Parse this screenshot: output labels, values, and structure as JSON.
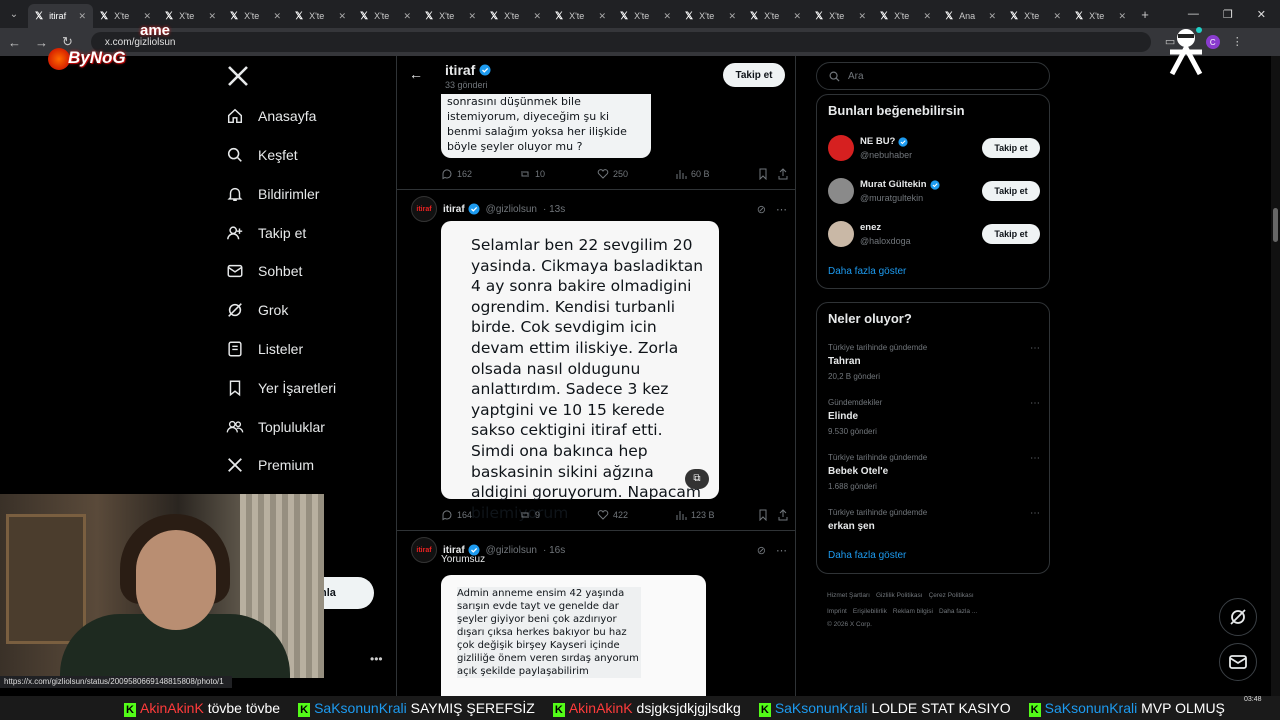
{
  "browser": {
    "tabs": [
      {
        "label": "itiraf",
        "active": true
      },
      {
        "label": "X'te"
      },
      {
        "label": "X'te"
      },
      {
        "label": "X'te"
      },
      {
        "label": "X'te"
      },
      {
        "label": "X'te"
      },
      {
        "label": "X'te"
      },
      {
        "label": "X'te"
      },
      {
        "label": "X'te"
      },
      {
        "label": "X'te"
      },
      {
        "label": "X'te"
      },
      {
        "label": "X'te"
      },
      {
        "label": "X'te"
      },
      {
        "label": "X'te"
      },
      {
        "label": "Ana"
      },
      {
        "label": "X'te"
      },
      {
        "label": "X'te"
      }
    ],
    "url": "x.com/gizliolsun",
    "status_url": "https://x.com/gizliolsun/status/2009580669148815808/photo/1",
    "profile_initial": "C"
  },
  "overlay": {
    "brand": "ByNoG",
    "brand_top": "ame"
  },
  "nav": {
    "items": [
      {
        "label": "Anasayfa",
        "icon": "home-icon"
      },
      {
        "label": "Keşfet",
        "icon": "search-icon"
      },
      {
        "label": "Bildirimler",
        "icon": "bell-icon"
      },
      {
        "label": "Takip et",
        "icon": "follow-icon"
      },
      {
        "label": "Sohbet",
        "icon": "mail-icon"
      },
      {
        "label": "Grok",
        "icon": "grok-icon"
      },
      {
        "label": "Listeler",
        "icon": "list-icon"
      },
      {
        "label": "Yer İşaretleri",
        "icon": "bookmark-icon"
      },
      {
        "label": "Topluluklar",
        "icon": "community-icon"
      },
      {
        "label": "Premium",
        "icon": "x-icon"
      }
    ],
    "post_button_fragment": "nla"
  },
  "header": {
    "name": "itiraf",
    "sub": "33 gönderi",
    "follow": "Takip et"
  },
  "posts": [
    {
      "image_text": "sonrasını düşünmek bile istemiyorum, diyeceğim şu ki benmi salağım yoksa her ilişkide böyle şeyler oluyor mu ?",
      "stats": {
        "replies": "162",
        "reposts": "10",
        "likes": "250",
        "views": "60 B"
      }
    },
    {
      "author": "itiraf",
      "handle": "@gizliolsun",
      "time": "· 13s",
      "image_text": "Selamlar ben 22 sevgilim 20 yasinda. Cikmaya basladiktan 4 ay sonra bakire olmadigini ogrendim. Kendisi turbanli birde. Cok sevdigim icin devam ettim iliskiye. Zorla olsada nasıl oldugunu anlattırdım. Sadece 3 kez yaptgini ve 10 15 kerede sakso cektigini itiraf etti. Simdi ona bakınca hep baskasinin sikini ağzına aldigini goruyorum. Napacam bilemiyorum",
      "stats": {
        "replies": "164",
        "reposts": "9",
        "likes": "422",
        "views": "123 B"
      }
    },
    {
      "author": "itiraf",
      "handle": "@gizliolsun",
      "time": "· 16s",
      "caption": "Yorumsuz",
      "image_text": "Admin anneme ensim 42 yaşında sarışın evde tayt ve genelde dar şeyler giyiyor beni çok azdırıyor dışarı çıksa herkes bakıyor bu haz çok değişik birşey Kayseri içinde gizliliğe önem veren sırdaş anyorum açık şekilde paylaşabilirim"
    }
  ],
  "avatar_label": "itiraf",
  "sidebar": {
    "search_placeholder": "Ara",
    "suggestions_title": "Bunları beğenebilirsin",
    "suggestions": [
      {
        "name": "NE BU?",
        "handle": "@nebuhaber",
        "follow": "Takip et",
        "color": "#d62020"
      },
      {
        "name": "Murat Gültekin",
        "handle": "@muratgultekin",
        "follow": "Takip et",
        "color": "#8a8a8a"
      },
      {
        "name": "enez",
        "handle": "@haloxdoga",
        "follow": "Takip et",
        "color": "#c9b8a6"
      }
    ],
    "show_more": "Daha fazla göster",
    "trends_title": "Neler oluyor?",
    "trends": [
      {
        "context": "Türkiye tarihinde gündemde",
        "title": "Tahran",
        "count": "20,2 B gönderi"
      },
      {
        "context": "Gündemdekiler",
        "title": "Elinde",
        "count": "9.530 gönderi"
      },
      {
        "context": "Türkiye tarihinde gündemde",
        "title": "Bebek Otel'e",
        "count": "1.688 gönderi"
      },
      {
        "context": "Türkiye tarihinde gündemde",
        "title": "erkan şen",
        "count": ""
      }
    ],
    "trends_more": "Daha fazla göster",
    "footer_line1": [
      "Hizmet Şartları",
      "Gizlilik Politikası",
      "Çerez Politikası"
    ],
    "footer_line2": [
      "Imprint",
      "Erişilebilirlik",
      "Reklam bilgisi",
      "Daha fazla ..."
    ],
    "copyright": "© 2026 X Corp."
  },
  "ticker": [
    {
      "user": "AkinAkinK",
      "msg": "tövbe tövbe",
      "red": true
    },
    {
      "user": "SaKsonunKrali",
      "msg": "SAYMIŞ ŞEREFSİZ"
    },
    {
      "user": "AkinAkinK",
      "msg": "dsjgksjdkjgjlsdkg",
      "red": true
    },
    {
      "user": "SaKsonunKrali",
      "msg": "LOLDE STAT KASIYO"
    },
    {
      "user": "SaKsonunKrali",
      "msg": "MVP OLMUŞ"
    }
  ],
  "clock": "03:48"
}
